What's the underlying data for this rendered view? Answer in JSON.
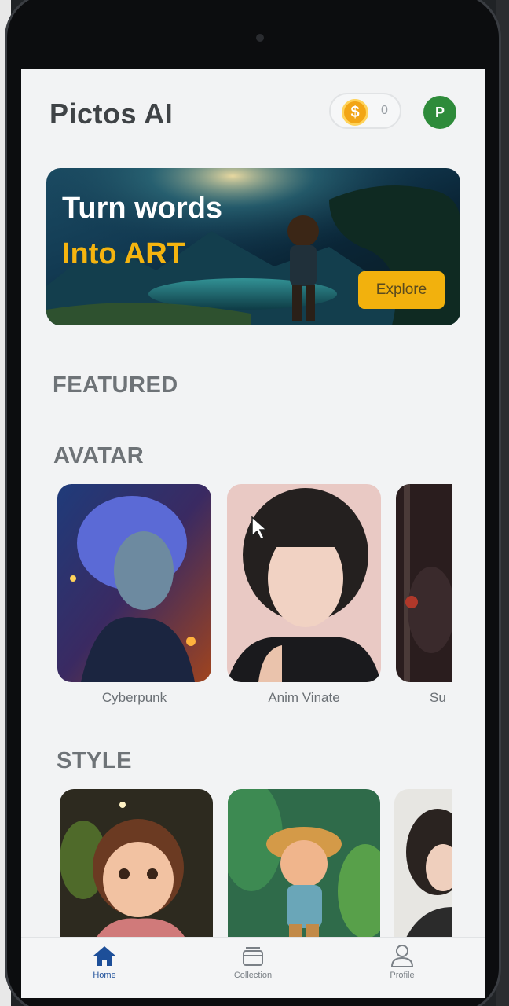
{
  "app": {
    "title": "Pictos AI"
  },
  "header": {
    "coin_icon": "dollar-coin-icon",
    "coin_symbol": "$",
    "coin_count": "0",
    "avatar_initial": "P"
  },
  "banner": {
    "line1": "Turn words",
    "line2": "Into ART",
    "button": "Explore"
  },
  "sections": {
    "featured": "FEATURED",
    "avatar": "AVATAR",
    "style": "STYLE"
  },
  "avatar_cards": [
    {
      "label": "Cyberpunk"
    },
    {
      "label": "Anim Vinate"
    },
    {
      "label": "Su"
    }
  ],
  "style_cards": [
    {
      "label": ""
    },
    {
      "label": ""
    },
    {
      "label": ""
    }
  ],
  "nav": {
    "home": "Home",
    "collection": "Collection",
    "profile": "Profile",
    "active": "home"
  },
  "colors": {
    "accent": "#f2b10d",
    "nav_active": "#1d4f99",
    "avatar_bg": "#2e8b3a",
    "text": "#3f4346"
  }
}
